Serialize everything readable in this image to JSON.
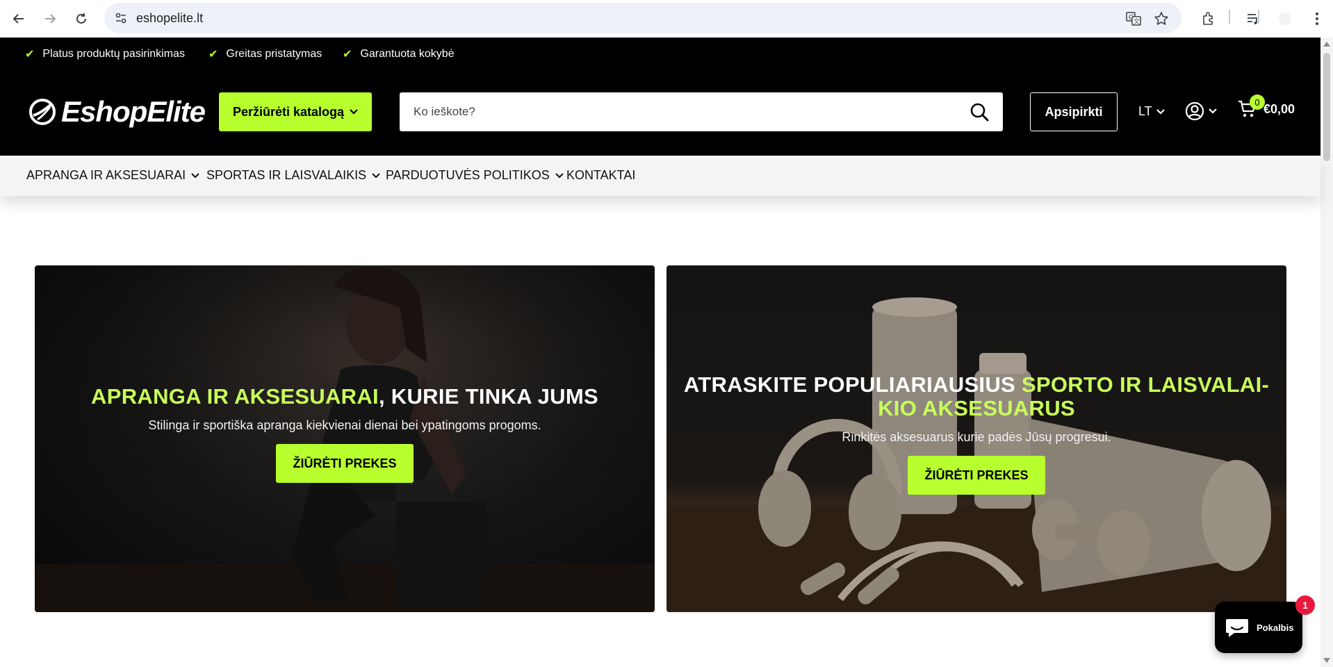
{
  "browser": {
    "url": "eshopelite.lt"
  },
  "top_strip": {
    "usps": [
      "Platus produktų pasirinkimas",
      "Greitas pristatymas",
      "Garantuota kokybė"
    ]
  },
  "header": {
    "logo_text": "EshopElite",
    "catalog_button": "Peržiūrėti katalogą",
    "search_placeholder": "Ko ieškote?",
    "shop_button": "Apsipirkti",
    "language": "LT",
    "cart_count": "0",
    "cart_total": "€0,00"
  },
  "main_nav": {
    "items": [
      "APRANGA IR AKSESUARAI",
      "SPORTAS IR LAISVALAIKIS",
      "PARDUOTUVĖS POLITIKOS",
      "KONTAKTAI"
    ]
  },
  "banners": {
    "left": {
      "title_highlight": "APRANGA IR AKSESUARAI",
      "title_rest": ", KURIE TINKA JUMS",
      "subtitle": "Stilinga ir sportiška apranga kiekvienai dienai bei ypatingoms progoms.",
      "button": "ŽIŪRĖTI PREKES"
    },
    "right": {
      "title_plain": "ATRASKITE POPULIARIAUSIUS ",
      "title_highlight_1": "SPORTO IR LAISVALAI-",
      "title_highlight_2": "KIO AKSESUARUS",
      "subtitle": "Rinkitės aksesuarus kurie padės Jūsų progresui.",
      "button": "ŽIŪRĖTI PREKES"
    }
  },
  "chat": {
    "label": "Pokalbis",
    "badge": "1"
  },
  "colors": {
    "accent": "#b8ff2e",
    "title_highlight": "#c8ff5a",
    "header_bg": "#000000",
    "nav_bg": "#f3f4f4",
    "badge": "#e8193c"
  }
}
